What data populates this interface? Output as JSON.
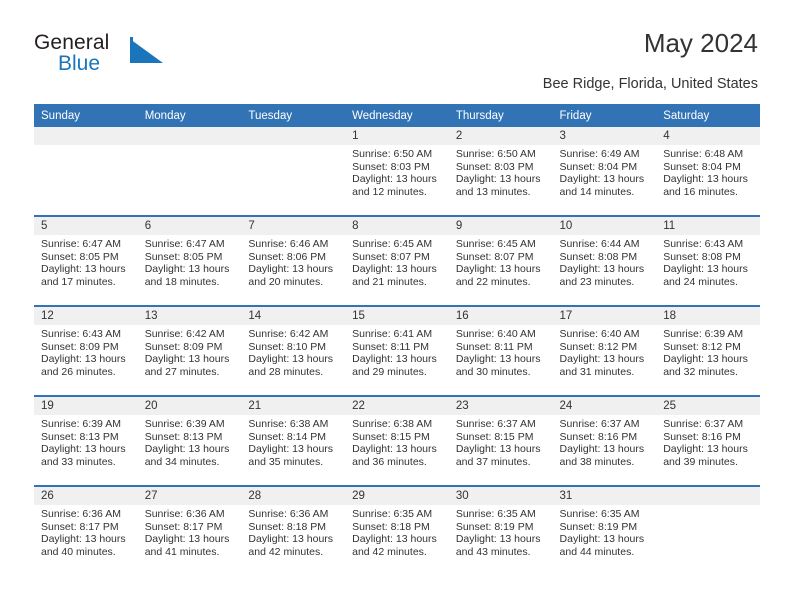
{
  "brand": {
    "name_top": "General",
    "name_bottom": "Blue",
    "accent_color": "#1b75bb",
    "logo_icon": "sail-triangle-icon"
  },
  "header": {
    "title": "May 2024",
    "location": "Bee Ridge, Florida, United States"
  },
  "theme": {
    "header_bg": "#3273b5",
    "daynum_band_bg": "#f0f0f0",
    "text_color": "#333333",
    "separator_color": "#3273b5"
  },
  "weekday_headers": [
    "Sunday",
    "Monday",
    "Tuesday",
    "Wednesday",
    "Thursday",
    "Friday",
    "Saturday"
  ],
  "weeks": [
    [
      {
        "day": "",
        "sunrise": "",
        "sunset": "",
        "daylight_1": "",
        "daylight_2": ""
      },
      {
        "day": "",
        "sunrise": "",
        "sunset": "",
        "daylight_1": "",
        "daylight_2": ""
      },
      {
        "day": "",
        "sunrise": "",
        "sunset": "",
        "daylight_1": "",
        "daylight_2": ""
      },
      {
        "day": "1",
        "sunrise": "Sunrise: 6:50 AM",
        "sunset": "Sunset: 8:03 PM",
        "daylight_1": "Daylight: 13 hours",
        "daylight_2": "and 12 minutes."
      },
      {
        "day": "2",
        "sunrise": "Sunrise: 6:50 AM",
        "sunset": "Sunset: 8:03 PM",
        "daylight_1": "Daylight: 13 hours",
        "daylight_2": "and 13 minutes."
      },
      {
        "day": "3",
        "sunrise": "Sunrise: 6:49 AM",
        "sunset": "Sunset: 8:04 PM",
        "daylight_1": "Daylight: 13 hours",
        "daylight_2": "and 14 minutes."
      },
      {
        "day": "4",
        "sunrise": "Sunrise: 6:48 AM",
        "sunset": "Sunset: 8:04 PM",
        "daylight_1": "Daylight: 13 hours",
        "daylight_2": "and 16 minutes."
      }
    ],
    [
      {
        "day": "5",
        "sunrise": "Sunrise: 6:47 AM",
        "sunset": "Sunset: 8:05 PM",
        "daylight_1": "Daylight: 13 hours",
        "daylight_2": "and 17 minutes."
      },
      {
        "day": "6",
        "sunrise": "Sunrise: 6:47 AM",
        "sunset": "Sunset: 8:05 PM",
        "daylight_1": "Daylight: 13 hours",
        "daylight_2": "and 18 minutes."
      },
      {
        "day": "7",
        "sunrise": "Sunrise: 6:46 AM",
        "sunset": "Sunset: 8:06 PM",
        "daylight_1": "Daylight: 13 hours",
        "daylight_2": "and 20 minutes."
      },
      {
        "day": "8",
        "sunrise": "Sunrise: 6:45 AM",
        "sunset": "Sunset: 8:07 PM",
        "daylight_1": "Daylight: 13 hours",
        "daylight_2": "and 21 minutes."
      },
      {
        "day": "9",
        "sunrise": "Sunrise: 6:45 AM",
        "sunset": "Sunset: 8:07 PM",
        "daylight_1": "Daylight: 13 hours",
        "daylight_2": "and 22 minutes."
      },
      {
        "day": "10",
        "sunrise": "Sunrise: 6:44 AM",
        "sunset": "Sunset: 8:08 PM",
        "daylight_1": "Daylight: 13 hours",
        "daylight_2": "and 23 minutes."
      },
      {
        "day": "11",
        "sunrise": "Sunrise: 6:43 AM",
        "sunset": "Sunset: 8:08 PM",
        "daylight_1": "Daylight: 13 hours",
        "daylight_2": "and 24 minutes."
      }
    ],
    [
      {
        "day": "12",
        "sunrise": "Sunrise: 6:43 AM",
        "sunset": "Sunset: 8:09 PM",
        "daylight_1": "Daylight: 13 hours",
        "daylight_2": "and 26 minutes."
      },
      {
        "day": "13",
        "sunrise": "Sunrise: 6:42 AM",
        "sunset": "Sunset: 8:09 PM",
        "daylight_1": "Daylight: 13 hours",
        "daylight_2": "and 27 minutes."
      },
      {
        "day": "14",
        "sunrise": "Sunrise: 6:42 AM",
        "sunset": "Sunset: 8:10 PM",
        "daylight_1": "Daylight: 13 hours",
        "daylight_2": "and 28 minutes."
      },
      {
        "day": "15",
        "sunrise": "Sunrise: 6:41 AM",
        "sunset": "Sunset: 8:11 PM",
        "daylight_1": "Daylight: 13 hours",
        "daylight_2": "and 29 minutes."
      },
      {
        "day": "16",
        "sunrise": "Sunrise: 6:40 AM",
        "sunset": "Sunset: 8:11 PM",
        "daylight_1": "Daylight: 13 hours",
        "daylight_2": "and 30 minutes."
      },
      {
        "day": "17",
        "sunrise": "Sunrise: 6:40 AM",
        "sunset": "Sunset: 8:12 PM",
        "daylight_1": "Daylight: 13 hours",
        "daylight_2": "and 31 minutes."
      },
      {
        "day": "18",
        "sunrise": "Sunrise: 6:39 AM",
        "sunset": "Sunset: 8:12 PM",
        "daylight_1": "Daylight: 13 hours",
        "daylight_2": "and 32 minutes."
      }
    ],
    [
      {
        "day": "19",
        "sunrise": "Sunrise: 6:39 AM",
        "sunset": "Sunset: 8:13 PM",
        "daylight_1": "Daylight: 13 hours",
        "daylight_2": "and 33 minutes."
      },
      {
        "day": "20",
        "sunrise": "Sunrise: 6:39 AM",
        "sunset": "Sunset: 8:13 PM",
        "daylight_1": "Daylight: 13 hours",
        "daylight_2": "and 34 minutes."
      },
      {
        "day": "21",
        "sunrise": "Sunrise: 6:38 AM",
        "sunset": "Sunset: 8:14 PM",
        "daylight_1": "Daylight: 13 hours",
        "daylight_2": "and 35 minutes."
      },
      {
        "day": "22",
        "sunrise": "Sunrise: 6:38 AM",
        "sunset": "Sunset: 8:15 PM",
        "daylight_1": "Daylight: 13 hours",
        "daylight_2": "and 36 minutes."
      },
      {
        "day": "23",
        "sunrise": "Sunrise: 6:37 AM",
        "sunset": "Sunset: 8:15 PM",
        "daylight_1": "Daylight: 13 hours",
        "daylight_2": "and 37 minutes."
      },
      {
        "day": "24",
        "sunrise": "Sunrise: 6:37 AM",
        "sunset": "Sunset: 8:16 PM",
        "daylight_1": "Daylight: 13 hours",
        "daylight_2": "and 38 minutes."
      },
      {
        "day": "25",
        "sunrise": "Sunrise: 6:37 AM",
        "sunset": "Sunset: 8:16 PM",
        "daylight_1": "Daylight: 13 hours",
        "daylight_2": "and 39 minutes."
      }
    ],
    [
      {
        "day": "26",
        "sunrise": "Sunrise: 6:36 AM",
        "sunset": "Sunset: 8:17 PM",
        "daylight_1": "Daylight: 13 hours",
        "daylight_2": "and 40 minutes."
      },
      {
        "day": "27",
        "sunrise": "Sunrise: 6:36 AM",
        "sunset": "Sunset: 8:17 PM",
        "daylight_1": "Daylight: 13 hours",
        "daylight_2": "and 41 minutes."
      },
      {
        "day": "28",
        "sunrise": "Sunrise: 6:36 AM",
        "sunset": "Sunset: 8:18 PM",
        "daylight_1": "Daylight: 13 hours",
        "daylight_2": "and 42 minutes."
      },
      {
        "day": "29",
        "sunrise": "Sunrise: 6:35 AM",
        "sunset": "Sunset: 8:18 PM",
        "daylight_1": "Daylight: 13 hours",
        "daylight_2": "and 42 minutes."
      },
      {
        "day": "30",
        "sunrise": "Sunrise: 6:35 AM",
        "sunset": "Sunset: 8:19 PM",
        "daylight_1": "Daylight: 13 hours",
        "daylight_2": "and 43 minutes."
      },
      {
        "day": "31",
        "sunrise": "Sunrise: 6:35 AM",
        "sunset": "Sunset: 8:19 PM",
        "daylight_1": "Daylight: 13 hours",
        "daylight_2": "and 44 minutes."
      },
      {
        "day": "",
        "sunrise": "",
        "sunset": "",
        "daylight_1": "",
        "daylight_2": ""
      }
    ]
  ]
}
